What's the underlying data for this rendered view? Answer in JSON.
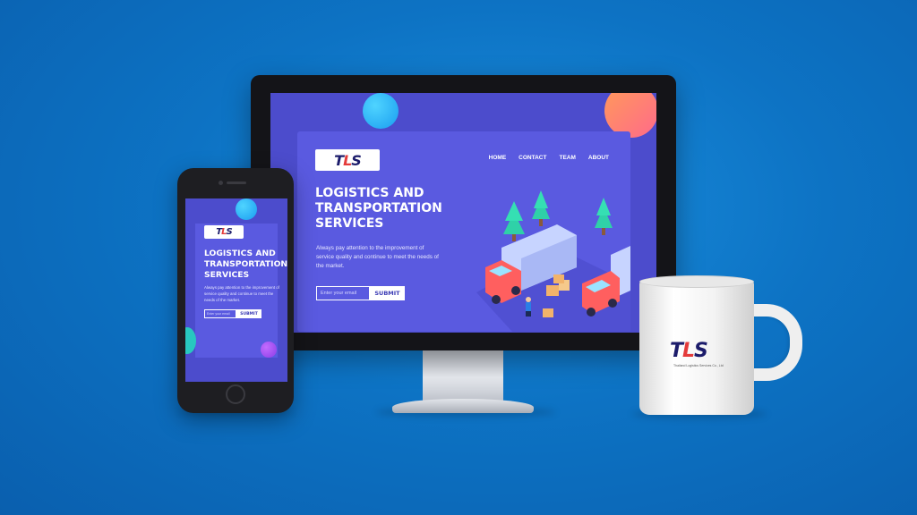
{
  "colors": {
    "background": "#0d73c4",
    "screen": "#4c4ccc",
    "card": "#5a5ae0",
    "accent_orange": "#ff7a6a",
    "accent_blue": "#2bb5f5"
  },
  "desktop": {
    "logo": {
      "a": "T",
      "b": "L",
      "c": "S"
    },
    "nav": [
      "HOME",
      "CONTACT",
      "TEAM",
      "ABOUT"
    ],
    "title_lines": [
      "LOGISTICS AND",
      "TRANSPORTATION",
      "SERVICES"
    ],
    "description": "Always pay attention to the improvement of service quality and continue to meet the needs of the market.",
    "email_placeholder": "Enter your email",
    "submit": "SUBMIT",
    "illustration": {
      "icons": [
        "tree-icon",
        "truck-icon",
        "box-icon",
        "person-icon"
      ]
    }
  },
  "mobile": {
    "logo": {
      "a": "T",
      "b": "L",
      "c": "S"
    },
    "title_lines": [
      "LOGISTICS AND",
      "TRANSPORTATION",
      "SERVICES"
    ],
    "description": "Always pay attention to the improvement of service quality and continue to meet the needs of the market.",
    "email_placeholder": "Enter your email",
    "submit": "SUBMIT"
  },
  "mug": {
    "logo": {
      "a": "T",
      "b": "L",
      "c": "S"
    },
    "tagline": "Thailand Logistics Services Co., Ltd"
  }
}
